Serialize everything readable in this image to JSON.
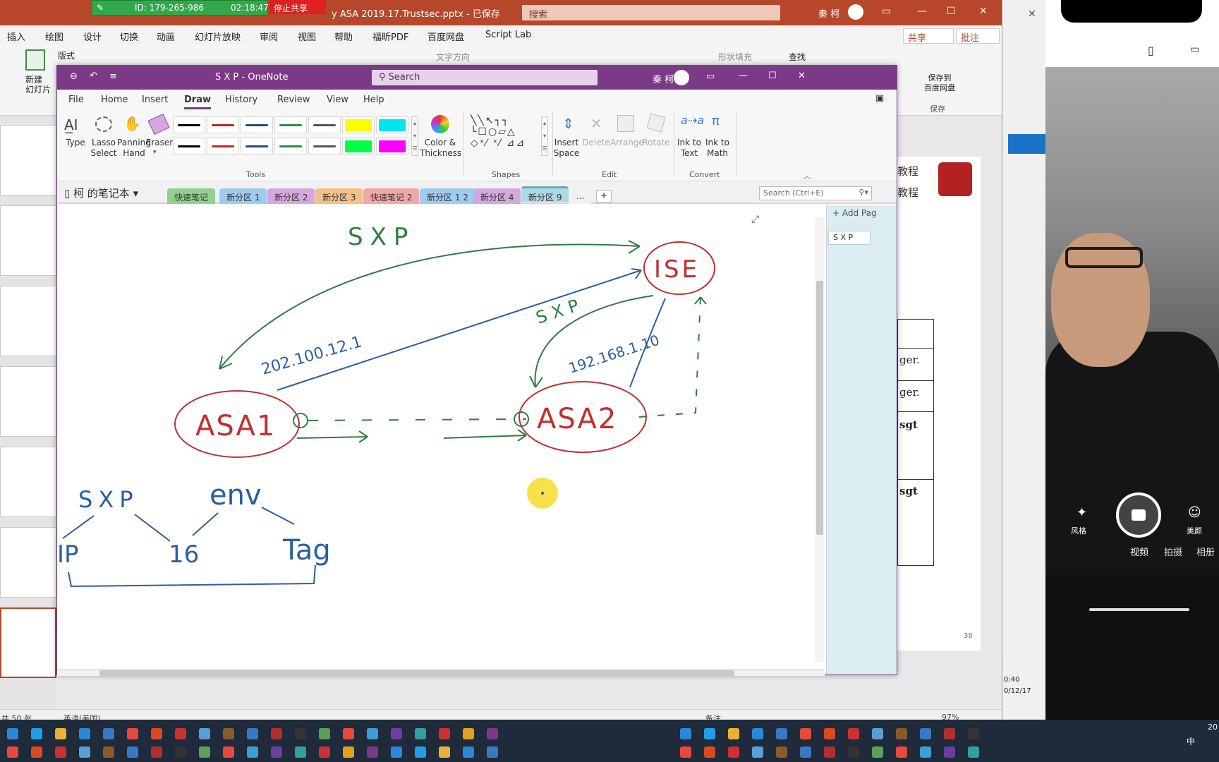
{
  "meeting": {
    "id_label": "ID: 179-265-986",
    "timer": "02:18:47",
    "stop_share": "停止共享"
  },
  "powerpoint": {
    "title": "y ASA 2019.17.Trustsec.pptx - 已保存",
    "search_placeholder": "搜索",
    "user": "秦 柯",
    "menu": [
      "插入",
      "绘图",
      "设计",
      "切换",
      "动画",
      "幻灯片放映",
      "审阅",
      "视图",
      "帮助",
      "福昕PDF",
      "百度网盘",
      "Script Lab"
    ],
    "share_btn": "共享",
    "comment_btn": "批注",
    "ribbon": {
      "layout": "版式",
      "new_slide": "新建\n幻灯片",
      "text_direction": "文字方向",
      "shape_fill": "形状填充",
      "find": "查找",
      "save_to_baidu": "保存到\n百度网盘",
      "save_group": "保存"
    },
    "slide_text": [
      "教程",
      "教程"
    ],
    "slide_table_cells": [
      "ger.",
      "ger.",
      "sgt",
      "sgt"
    ],
    "slide_number": "38",
    "status_left": "共 50 张",
    "status_lang": "英语(美国)",
    "status_notes": "备注",
    "zoom": "97%"
  },
  "onenote": {
    "title": "S X P  -  OneNote",
    "search_placeholder": "Search",
    "user": "秦 柯",
    "tabs": [
      "File",
      "Home",
      "Insert",
      "Draw",
      "History",
      "Review",
      "View",
      "Help"
    ],
    "active_tab": "Draw",
    "ribbon": {
      "type": "Type",
      "lasso": "Lasso\nSelect",
      "panning": "Panning\nHand",
      "eraser": "Eraser",
      "color_thickness": "Color &\nThickness",
      "insert_space": "Insert\nSpace",
      "delete": "Delete",
      "arrange": "Arrange",
      "rotate": "Rotate",
      "ink_to_text": "Ink to\nText",
      "ink_to_math": "Ink to\nMath",
      "group_tools": "Tools",
      "group_shapes": "Shapes",
      "group_edit": "Edit",
      "group_convert": "Convert",
      "pen_colors": [
        "#000000",
        "#cc2222",
        "#1f4e79",
        "#2e8b3e",
        "#555555",
        "#ffff00",
        "#00e5ee",
        "#000000",
        "#cc2222",
        "#1f4e79",
        "#2e8b3e",
        "#555555",
        "#00ff44",
        "#ff00ff"
      ]
    },
    "notebook": "柯 的笔记本",
    "sections": [
      {
        "label": "快速笔记",
        "color": "#8fd18f"
      },
      {
        "label": "新分区 1",
        "color": "#9fcbf0"
      },
      {
        "label": "新分区 2",
        "color": "#d3a8dd"
      },
      {
        "label": "新分区 3",
        "color": "#f3c08a"
      },
      {
        "label": "快速笔记 2",
        "color": "#f2a8a8"
      },
      {
        "label": "新分区 1 2",
        "color": "#9fcbf0"
      },
      {
        "label": "新分区 4",
        "color": "#d3a8dd"
      },
      {
        "label": "新分区 9",
        "color": "#a8dbe6"
      },
      {
        "label": "...",
        "color": "#f1f1f1"
      }
    ],
    "page_search_placeholder": "Search (Ctrl+E)",
    "add_page": "Add Pag",
    "pages": [
      "S X P"
    ],
    "ink_text": {
      "sxp_top": "SXP",
      "ise": "ISE",
      "sxp_mid": "SXP",
      "ip1": "202.100.12.1",
      "ip2": "192.168.1.10",
      "asa1": "ASA1",
      "asa2": "ASA2",
      "sxp_bottom": "SXP",
      "env": "env",
      "ip": "IP",
      "num16": "16",
      "tag": "Tag"
    }
  },
  "phone": {
    "controls": [
      "风格",
      "美颜"
    ],
    "modes": [
      "视频",
      "拍摄",
      "相册"
    ],
    "clock": "0:40",
    "date": "0/12/17"
  },
  "taskbar": {
    "ime": "中",
    "time": "20"
  }
}
